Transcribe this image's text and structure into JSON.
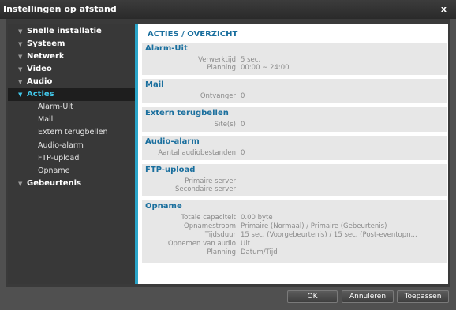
{
  "window": {
    "title": "Instellingen op afstand",
    "close_label": "x"
  },
  "sidebar": {
    "items": [
      {
        "label": "Snelle installatie"
      },
      {
        "label": "Systeem"
      },
      {
        "label": "Netwerk"
      },
      {
        "label": "Video"
      },
      {
        "label": "Audio"
      },
      {
        "label": "Acties"
      },
      {
        "label": "Gebeurtenis"
      }
    ],
    "subitems": [
      {
        "label": "Alarm-Uit"
      },
      {
        "label": "Mail"
      },
      {
        "label": "Extern terugbellen"
      },
      {
        "label": "Audio-alarm"
      },
      {
        "label": "FTP-upload"
      },
      {
        "label": "Opname"
      }
    ]
  },
  "main": {
    "title": "ACTIES / OVERZICHT",
    "sections": {
      "alarm_uit": {
        "title": "Alarm-Uit",
        "rows": [
          {
            "label": "Verwerktijd",
            "value": "5 sec."
          },
          {
            "label": "Planning",
            "value": "00:00 ~ 24:00"
          }
        ]
      },
      "mail": {
        "title": "Mail",
        "rows": [
          {
            "label": "Ontvanger",
            "value": "0"
          }
        ]
      },
      "extern": {
        "title": "Extern terugbellen",
        "rows": [
          {
            "label": "Site(s)",
            "value": "0"
          }
        ]
      },
      "audio_alarm": {
        "title": "Audio-alarm",
        "rows": [
          {
            "label": "Aantal audiobestanden",
            "value": "0"
          }
        ]
      },
      "ftp": {
        "title": "FTP-upload",
        "rows": [
          {
            "label": "Primaire server",
            "value": ""
          },
          {
            "label": "Secondaire server",
            "value": ""
          }
        ]
      },
      "opname": {
        "title": "Opname",
        "rows": [
          {
            "label": "Totale capaciteit",
            "value": "0.00 byte"
          },
          {
            "label": "Opnamestroom",
            "value": "Primaire (Normaal) / Primaire (Gebeurtenis)"
          },
          {
            "label": "Tijdsduur",
            "value": "15 sec. (Voorgebeurtenis) / 15 sec. (Post-eventopn..."
          },
          {
            "label": "Opnemen van audio",
            "value": "Uit"
          },
          {
            "label": "Planning",
            "value": "Datum/Tijd"
          }
        ]
      }
    }
  },
  "footer": {
    "ok_label": "OK",
    "cancel_label": "Annuleren",
    "apply_label": "Toepassen"
  },
  "colors": {
    "accent": "#41c6e8",
    "section_title": "#1a6f9e",
    "panel_border": "#2aa4c8"
  }
}
